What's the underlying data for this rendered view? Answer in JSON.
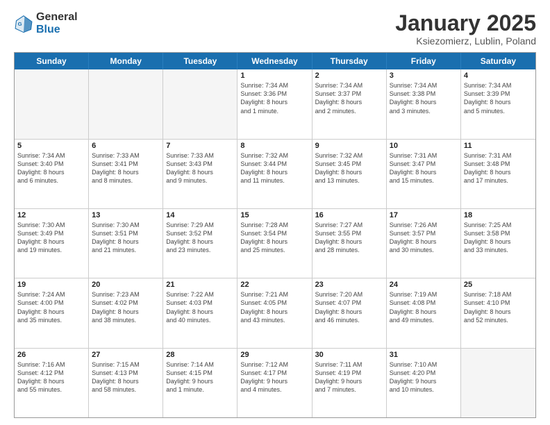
{
  "header": {
    "logo_line1": "General",
    "logo_line2": "Blue",
    "month": "January 2025",
    "location": "Ksiezomierz, Lublin, Poland"
  },
  "days_of_week": [
    "Sunday",
    "Monday",
    "Tuesday",
    "Wednesday",
    "Thursday",
    "Friday",
    "Saturday"
  ],
  "weeks": [
    [
      {
        "day": "",
        "text": "",
        "empty": true
      },
      {
        "day": "",
        "text": "",
        "empty": true
      },
      {
        "day": "",
        "text": "",
        "empty": true
      },
      {
        "day": "1",
        "text": "Sunrise: 7:34 AM\nSunset: 3:36 PM\nDaylight: 8 hours\nand 1 minute."
      },
      {
        "day": "2",
        "text": "Sunrise: 7:34 AM\nSunset: 3:37 PM\nDaylight: 8 hours\nand 2 minutes."
      },
      {
        "day": "3",
        "text": "Sunrise: 7:34 AM\nSunset: 3:38 PM\nDaylight: 8 hours\nand 3 minutes."
      },
      {
        "day": "4",
        "text": "Sunrise: 7:34 AM\nSunset: 3:39 PM\nDaylight: 8 hours\nand 5 minutes."
      }
    ],
    [
      {
        "day": "5",
        "text": "Sunrise: 7:34 AM\nSunset: 3:40 PM\nDaylight: 8 hours\nand 6 minutes."
      },
      {
        "day": "6",
        "text": "Sunrise: 7:33 AM\nSunset: 3:41 PM\nDaylight: 8 hours\nand 8 minutes."
      },
      {
        "day": "7",
        "text": "Sunrise: 7:33 AM\nSunset: 3:43 PM\nDaylight: 8 hours\nand 9 minutes."
      },
      {
        "day": "8",
        "text": "Sunrise: 7:32 AM\nSunset: 3:44 PM\nDaylight: 8 hours\nand 11 minutes."
      },
      {
        "day": "9",
        "text": "Sunrise: 7:32 AM\nSunset: 3:45 PM\nDaylight: 8 hours\nand 13 minutes."
      },
      {
        "day": "10",
        "text": "Sunrise: 7:31 AM\nSunset: 3:47 PM\nDaylight: 8 hours\nand 15 minutes."
      },
      {
        "day": "11",
        "text": "Sunrise: 7:31 AM\nSunset: 3:48 PM\nDaylight: 8 hours\nand 17 minutes."
      }
    ],
    [
      {
        "day": "12",
        "text": "Sunrise: 7:30 AM\nSunset: 3:49 PM\nDaylight: 8 hours\nand 19 minutes."
      },
      {
        "day": "13",
        "text": "Sunrise: 7:30 AM\nSunset: 3:51 PM\nDaylight: 8 hours\nand 21 minutes."
      },
      {
        "day": "14",
        "text": "Sunrise: 7:29 AM\nSunset: 3:52 PM\nDaylight: 8 hours\nand 23 minutes."
      },
      {
        "day": "15",
        "text": "Sunrise: 7:28 AM\nSunset: 3:54 PM\nDaylight: 8 hours\nand 25 minutes."
      },
      {
        "day": "16",
        "text": "Sunrise: 7:27 AM\nSunset: 3:55 PM\nDaylight: 8 hours\nand 28 minutes."
      },
      {
        "day": "17",
        "text": "Sunrise: 7:26 AM\nSunset: 3:57 PM\nDaylight: 8 hours\nand 30 minutes."
      },
      {
        "day": "18",
        "text": "Sunrise: 7:25 AM\nSunset: 3:58 PM\nDaylight: 8 hours\nand 33 minutes."
      }
    ],
    [
      {
        "day": "19",
        "text": "Sunrise: 7:24 AM\nSunset: 4:00 PM\nDaylight: 8 hours\nand 35 minutes."
      },
      {
        "day": "20",
        "text": "Sunrise: 7:23 AM\nSunset: 4:02 PM\nDaylight: 8 hours\nand 38 minutes."
      },
      {
        "day": "21",
        "text": "Sunrise: 7:22 AM\nSunset: 4:03 PM\nDaylight: 8 hours\nand 40 minutes."
      },
      {
        "day": "22",
        "text": "Sunrise: 7:21 AM\nSunset: 4:05 PM\nDaylight: 8 hours\nand 43 minutes."
      },
      {
        "day": "23",
        "text": "Sunrise: 7:20 AM\nSunset: 4:07 PM\nDaylight: 8 hours\nand 46 minutes."
      },
      {
        "day": "24",
        "text": "Sunrise: 7:19 AM\nSunset: 4:08 PM\nDaylight: 8 hours\nand 49 minutes."
      },
      {
        "day": "25",
        "text": "Sunrise: 7:18 AM\nSunset: 4:10 PM\nDaylight: 8 hours\nand 52 minutes."
      }
    ],
    [
      {
        "day": "26",
        "text": "Sunrise: 7:16 AM\nSunset: 4:12 PM\nDaylight: 8 hours\nand 55 minutes."
      },
      {
        "day": "27",
        "text": "Sunrise: 7:15 AM\nSunset: 4:13 PM\nDaylight: 8 hours\nand 58 minutes."
      },
      {
        "day": "28",
        "text": "Sunrise: 7:14 AM\nSunset: 4:15 PM\nDaylight: 9 hours\nand 1 minute."
      },
      {
        "day": "29",
        "text": "Sunrise: 7:12 AM\nSunset: 4:17 PM\nDaylight: 9 hours\nand 4 minutes."
      },
      {
        "day": "30",
        "text": "Sunrise: 7:11 AM\nSunset: 4:19 PM\nDaylight: 9 hours\nand 7 minutes."
      },
      {
        "day": "31",
        "text": "Sunrise: 7:10 AM\nSunset: 4:20 PM\nDaylight: 9 hours\nand 10 minutes."
      },
      {
        "day": "",
        "text": "",
        "empty": true
      }
    ]
  ]
}
